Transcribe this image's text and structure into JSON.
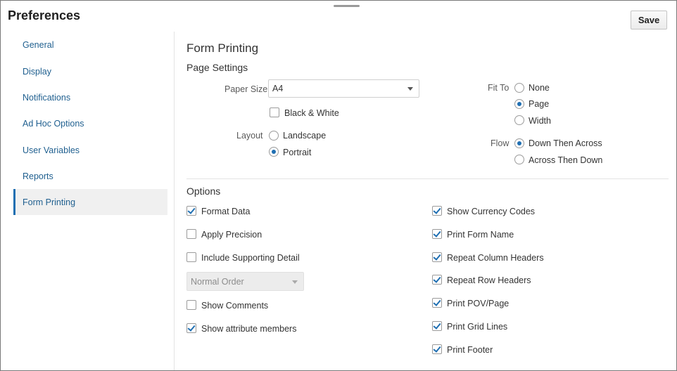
{
  "header": {
    "title": "Preferences",
    "save_label": "Save"
  },
  "sidebar": {
    "items": [
      {
        "label": "General"
      },
      {
        "label": "Display"
      },
      {
        "label": "Notifications"
      },
      {
        "label": "Ad Hoc Options"
      },
      {
        "label": "User Variables"
      },
      {
        "label": "Reports"
      },
      {
        "label": "Form Printing",
        "active": true
      }
    ]
  },
  "main": {
    "title": "Form Printing",
    "page_settings": {
      "heading": "Page Settings",
      "paper_size_label": "Paper Size",
      "paper_size_value": "A4",
      "black_white_label": "Black & White",
      "black_white_checked": false,
      "layout_label": "Layout",
      "layout_options": [
        "Landscape",
        "Portrait"
      ],
      "layout_selected": "Portrait",
      "fit_to_label": "Fit To",
      "fit_to_options": [
        "None",
        "Page",
        "Width"
      ],
      "fit_to_selected": "Page",
      "flow_label": "Flow",
      "flow_options": [
        "Down Then Across",
        "Across Then Down"
      ],
      "flow_selected": "Down Then Across"
    },
    "options": {
      "heading": "Options",
      "format_data": "Format Data",
      "apply_precision": "Apply Precision",
      "include_supporting_detail": "Include Supporting Detail",
      "order_select_value": "Normal Order",
      "show_comments": "Show Comments",
      "show_attribute_members": "Show attribute members",
      "show_currency_codes": "Show Currency Codes",
      "print_form_name": "Print Form Name",
      "repeat_column_headers": "Repeat Column Headers",
      "repeat_row_headers": "Repeat Row Headers",
      "print_pov_page": "Print POV/Page",
      "print_grid_lines": "Print Grid Lines",
      "print_footer": "Print Footer",
      "checked": {
        "format_data": true,
        "apply_precision": false,
        "include_supporting_detail": false,
        "show_comments": false,
        "show_attribute_members": true,
        "show_currency_codes": true,
        "print_form_name": true,
        "repeat_column_headers": true,
        "repeat_row_headers": true,
        "print_pov_page": true,
        "print_grid_lines": true,
        "print_footer": true
      }
    }
  },
  "colors": {
    "accent": "#1f6fb2",
    "link": "#1f5f8f",
    "active_bg": "#f0f0f0"
  }
}
